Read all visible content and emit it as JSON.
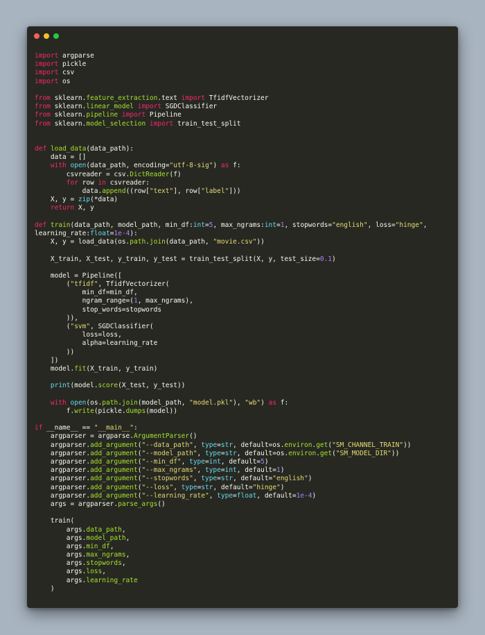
{
  "window": {
    "traffic_lights": [
      "close",
      "minimize",
      "zoom"
    ],
    "colors": {
      "close": "#ff5f56",
      "minimize": "#ffbd2e",
      "zoom": "#27c93f",
      "background": "#272822",
      "page_background": "#a8b4c0"
    }
  },
  "editor": {
    "syntax_colors": {
      "kw": "#f92672",
      "str": "#e6db74",
      "num": "#ae81ff",
      "fn": "#a6e22e",
      "ty": "#66d9ef",
      "pl": "#f8f8f2"
    },
    "lines": [
      [
        [
          "kw",
          "import"
        ],
        [
          "pl",
          " argparse"
        ]
      ],
      [
        [
          "kw",
          "import"
        ],
        [
          "pl",
          " pickle"
        ]
      ],
      [
        [
          "kw",
          "import"
        ],
        [
          "pl",
          " csv"
        ]
      ],
      [
        [
          "kw",
          "import"
        ],
        [
          "pl",
          " os"
        ]
      ],
      [],
      [
        [
          "kw",
          "from"
        ],
        [
          "pl",
          " sklearn."
        ],
        [
          "fn",
          "feature_extraction"
        ],
        [
          "pl",
          ".text "
        ],
        [
          "kw",
          "import"
        ],
        [
          "pl",
          " TfidfVectorizer"
        ]
      ],
      [
        [
          "kw",
          "from"
        ],
        [
          "pl",
          " sklearn."
        ],
        [
          "fn",
          "linear_model"
        ],
        [
          "pl",
          " "
        ],
        [
          "kw",
          "import"
        ],
        [
          "pl",
          " SGDClassifier"
        ]
      ],
      [
        [
          "kw",
          "from"
        ],
        [
          "pl",
          " sklearn."
        ],
        [
          "fn",
          "pipeline"
        ],
        [
          "pl",
          " "
        ],
        [
          "kw",
          "import"
        ],
        [
          "pl",
          " Pipeline"
        ]
      ],
      [
        [
          "kw",
          "from"
        ],
        [
          "pl",
          " sklearn."
        ],
        [
          "fn",
          "model_selection"
        ],
        [
          "pl",
          " "
        ],
        [
          "kw",
          "import"
        ],
        [
          "pl",
          " train_test_split"
        ]
      ],
      [],
      [],
      [
        [
          "kw",
          "def"
        ],
        [
          "pl",
          " "
        ],
        [
          "fn",
          "load_data"
        ],
        [
          "pl",
          "(data_path):"
        ]
      ],
      [
        [
          "pl",
          "    data = []"
        ]
      ],
      [
        [
          "pl",
          "    "
        ],
        [
          "kw",
          "with"
        ],
        [
          "pl",
          " "
        ],
        [
          "ty",
          "open"
        ],
        [
          "pl",
          "(data_path, encoding="
        ],
        [
          "str",
          "\"utf-8-sig\""
        ],
        [
          "pl",
          ") "
        ],
        [
          "kw",
          "as"
        ],
        [
          "pl",
          " f:"
        ]
      ],
      [
        [
          "pl",
          "        csvreader = csv."
        ],
        [
          "fn",
          "DictReader"
        ],
        [
          "pl",
          "(f)"
        ]
      ],
      [
        [
          "pl",
          "        "
        ],
        [
          "kw",
          "for"
        ],
        [
          "pl",
          " row "
        ],
        [
          "kw",
          "in"
        ],
        [
          "pl",
          " csvreader:"
        ]
      ],
      [
        [
          "pl",
          "            data."
        ],
        [
          "fn",
          "append"
        ],
        [
          "pl",
          "((row["
        ],
        [
          "str",
          "\"text\""
        ],
        [
          "pl",
          "], row["
        ],
        [
          "str",
          "\"label\""
        ],
        [
          "pl",
          "]))"
        ]
      ],
      [
        [
          "pl",
          "    X, y = "
        ],
        [
          "ty",
          "zip"
        ],
        [
          "pl",
          "(*data)"
        ]
      ],
      [
        [
          "pl",
          "    "
        ],
        [
          "kw",
          "return"
        ],
        [
          "pl",
          " X, y"
        ]
      ],
      [],
      [
        [
          "kw",
          "def"
        ],
        [
          "pl",
          " "
        ],
        [
          "fn",
          "train"
        ],
        [
          "pl",
          "(data_path, model_path, min_df:"
        ],
        [
          "ty",
          "int"
        ],
        [
          "pl",
          "="
        ],
        [
          "num",
          "5"
        ],
        [
          "pl",
          ", max_ngrams:"
        ],
        [
          "ty",
          "int"
        ],
        [
          "pl",
          "="
        ],
        [
          "num",
          "1"
        ],
        [
          "pl",
          ", stopwords="
        ],
        [
          "str",
          "\"english\""
        ],
        [
          "pl",
          ", loss="
        ],
        [
          "str",
          "\"hinge\""
        ],
        [
          "pl",
          ","
        ]
      ],
      [
        [
          "pl",
          "learning_rate:"
        ],
        [
          "ty",
          "float"
        ],
        [
          "pl",
          "="
        ],
        [
          "num",
          "1e-4"
        ],
        [
          "pl",
          "):"
        ]
      ],
      [
        [
          "pl",
          "    X, y = load_data(os."
        ],
        [
          "fn",
          "path"
        ],
        [
          "pl",
          "."
        ],
        [
          "fn",
          "join"
        ],
        [
          "pl",
          "(data_path, "
        ],
        [
          "str",
          "\"movie.csv\""
        ],
        [
          "pl",
          "))"
        ]
      ],
      [],
      [
        [
          "pl",
          "    X_train, X_test, y_train, y_test = train_test_split(X, y, test_size="
        ],
        [
          "num",
          "0.1"
        ],
        [
          "pl",
          ")"
        ]
      ],
      [],
      [
        [
          "pl",
          "    model = Pipeline(["
        ]
      ],
      [
        [
          "pl",
          "        ("
        ],
        [
          "str",
          "\"tfidf\""
        ],
        [
          "pl",
          ", TfidfVectorizer("
        ]
      ],
      [
        [
          "pl",
          "            min_df=min_df,"
        ]
      ],
      [
        [
          "pl",
          "            ngram_range=("
        ],
        [
          "num",
          "1"
        ],
        [
          "pl",
          ", max_ngrams),"
        ]
      ],
      [
        [
          "pl",
          "            stop_words=stopwords"
        ]
      ],
      [
        [
          "pl",
          "        )),"
        ]
      ],
      [
        [
          "pl",
          "        ("
        ],
        [
          "str",
          "\"svm\""
        ],
        [
          "pl",
          ", SGDClassifier("
        ]
      ],
      [
        [
          "pl",
          "            loss=loss,"
        ]
      ],
      [
        [
          "pl",
          "            alpha=learning_rate"
        ]
      ],
      [
        [
          "pl",
          "        ))"
        ]
      ],
      [
        [
          "pl",
          "    ])"
        ]
      ],
      [
        [
          "pl",
          "    model."
        ],
        [
          "fn",
          "fit"
        ],
        [
          "pl",
          "(X_train, y_train)"
        ]
      ],
      [],
      [
        [
          "pl",
          "    "
        ],
        [
          "ty",
          "print"
        ],
        [
          "pl",
          "(model."
        ],
        [
          "fn",
          "score"
        ],
        [
          "pl",
          "(X_test, y_test))"
        ]
      ],
      [],
      [
        [
          "pl",
          "    "
        ],
        [
          "kw",
          "with"
        ],
        [
          "pl",
          " "
        ],
        [
          "ty",
          "open"
        ],
        [
          "pl",
          "(os."
        ],
        [
          "fn",
          "path"
        ],
        [
          "pl",
          "."
        ],
        [
          "fn",
          "join"
        ],
        [
          "pl",
          "(model_path, "
        ],
        [
          "str",
          "\"model.pkl\""
        ],
        [
          "pl",
          "), "
        ],
        [
          "str",
          "\"wb\""
        ],
        [
          "pl",
          ") "
        ],
        [
          "kw",
          "as"
        ],
        [
          "pl",
          " f:"
        ]
      ],
      [
        [
          "pl",
          "        f."
        ],
        [
          "fn",
          "write"
        ],
        [
          "pl",
          "(pickle."
        ],
        [
          "fn",
          "dumps"
        ],
        [
          "pl",
          "(model))"
        ]
      ],
      [],
      [
        [
          "kw",
          "if"
        ],
        [
          "pl",
          " __name__ == "
        ],
        [
          "str",
          "\"__main__\""
        ],
        [
          "pl",
          ":"
        ]
      ],
      [
        [
          "pl",
          "    argparser = argparse."
        ],
        [
          "fn",
          "ArgumentParser"
        ],
        [
          "pl",
          "()"
        ]
      ],
      [
        [
          "pl",
          "    argparser."
        ],
        [
          "fn",
          "add_argument"
        ],
        [
          "pl",
          "("
        ],
        [
          "str",
          "\"--data_path\""
        ],
        [
          "pl",
          ", "
        ],
        [
          "ty",
          "type"
        ],
        [
          "pl",
          "="
        ],
        [
          "ty",
          "str"
        ],
        [
          "pl",
          ", default=os."
        ],
        [
          "fn",
          "environ"
        ],
        [
          "pl",
          "."
        ],
        [
          "fn",
          "get"
        ],
        [
          "pl",
          "("
        ],
        [
          "str",
          "\"SM_CHANNEL_TRAIN\""
        ],
        [
          "pl",
          "))"
        ]
      ],
      [
        [
          "pl",
          "    argparser."
        ],
        [
          "fn",
          "add_argument"
        ],
        [
          "pl",
          "("
        ],
        [
          "str",
          "\"--model_path\""
        ],
        [
          "pl",
          ", "
        ],
        [
          "ty",
          "type"
        ],
        [
          "pl",
          "="
        ],
        [
          "ty",
          "str"
        ],
        [
          "pl",
          ", default=os."
        ],
        [
          "fn",
          "environ"
        ],
        [
          "pl",
          "."
        ],
        [
          "fn",
          "get"
        ],
        [
          "pl",
          "("
        ],
        [
          "str",
          "\"SM_MODEL_DIR\""
        ],
        [
          "pl",
          "))"
        ]
      ],
      [
        [
          "pl",
          "    argparser."
        ],
        [
          "fn",
          "add_argument"
        ],
        [
          "pl",
          "("
        ],
        [
          "str",
          "\"--min_df\""
        ],
        [
          "pl",
          ", "
        ],
        [
          "ty",
          "type"
        ],
        [
          "pl",
          "="
        ],
        [
          "ty",
          "int"
        ],
        [
          "pl",
          ", default="
        ],
        [
          "num",
          "5"
        ],
        [
          "pl",
          ")"
        ]
      ],
      [
        [
          "pl",
          "    argparser."
        ],
        [
          "fn",
          "add_argument"
        ],
        [
          "pl",
          "("
        ],
        [
          "str",
          "\"--max_ngrams\""
        ],
        [
          "pl",
          ", "
        ],
        [
          "ty",
          "type"
        ],
        [
          "pl",
          "="
        ],
        [
          "ty",
          "int"
        ],
        [
          "pl",
          ", default="
        ],
        [
          "num",
          "1"
        ],
        [
          "pl",
          ")"
        ]
      ],
      [
        [
          "pl",
          "    argparser."
        ],
        [
          "fn",
          "add_argument"
        ],
        [
          "pl",
          "("
        ],
        [
          "str",
          "\"--stopwords\""
        ],
        [
          "pl",
          ", "
        ],
        [
          "ty",
          "type"
        ],
        [
          "pl",
          "="
        ],
        [
          "ty",
          "str"
        ],
        [
          "pl",
          ", default="
        ],
        [
          "str",
          "\"english\""
        ],
        [
          "pl",
          ")"
        ]
      ],
      [
        [
          "pl",
          "    argparser."
        ],
        [
          "fn",
          "add_argument"
        ],
        [
          "pl",
          "("
        ],
        [
          "str",
          "\"--loss\""
        ],
        [
          "pl",
          ", "
        ],
        [
          "ty",
          "type"
        ],
        [
          "pl",
          "="
        ],
        [
          "ty",
          "str"
        ],
        [
          "pl",
          ", default="
        ],
        [
          "str",
          "\"hinge\""
        ],
        [
          "pl",
          ")"
        ]
      ],
      [
        [
          "pl",
          "    argparser."
        ],
        [
          "fn",
          "add_argument"
        ],
        [
          "pl",
          "("
        ],
        [
          "str",
          "\"--learning_rate\""
        ],
        [
          "pl",
          ", "
        ],
        [
          "ty",
          "type"
        ],
        [
          "pl",
          "="
        ],
        [
          "ty",
          "float"
        ],
        [
          "pl",
          ", default="
        ],
        [
          "num",
          "1e-4"
        ],
        [
          "pl",
          ")"
        ]
      ],
      [
        [
          "pl",
          "    args = argparser."
        ],
        [
          "fn",
          "parse_args"
        ],
        [
          "pl",
          "()"
        ]
      ],
      [],
      [
        [
          "pl",
          "    train("
        ]
      ],
      [
        [
          "pl",
          "        args."
        ],
        [
          "fn",
          "data_path"
        ],
        [
          "pl",
          ","
        ]
      ],
      [
        [
          "pl",
          "        args."
        ],
        [
          "fn",
          "model_path"
        ],
        [
          "pl",
          ","
        ]
      ],
      [
        [
          "pl",
          "        args."
        ],
        [
          "fn",
          "min_df"
        ],
        [
          "pl",
          ","
        ]
      ],
      [
        [
          "pl",
          "        args."
        ],
        [
          "fn",
          "max_ngrams"
        ],
        [
          "pl",
          ","
        ]
      ],
      [
        [
          "pl",
          "        args."
        ],
        [
          "fn",
          "stopwords"
        ],
        [
          "pl",
          ","
        ]
      ],
      [
        [
          "pl",
          "        args."
        ],
        [
          "fn",
          "loss"
        ],
        [
          "pl",
          ","
        ]
      ],
      [
        [
          "pl",
          "        args."
        ],
        [
          "fn",
          "learning_rate"
        ]
      ],
      [
        [
          "pl",
          "    )"
        ]
      ]
    ]
  }
}
